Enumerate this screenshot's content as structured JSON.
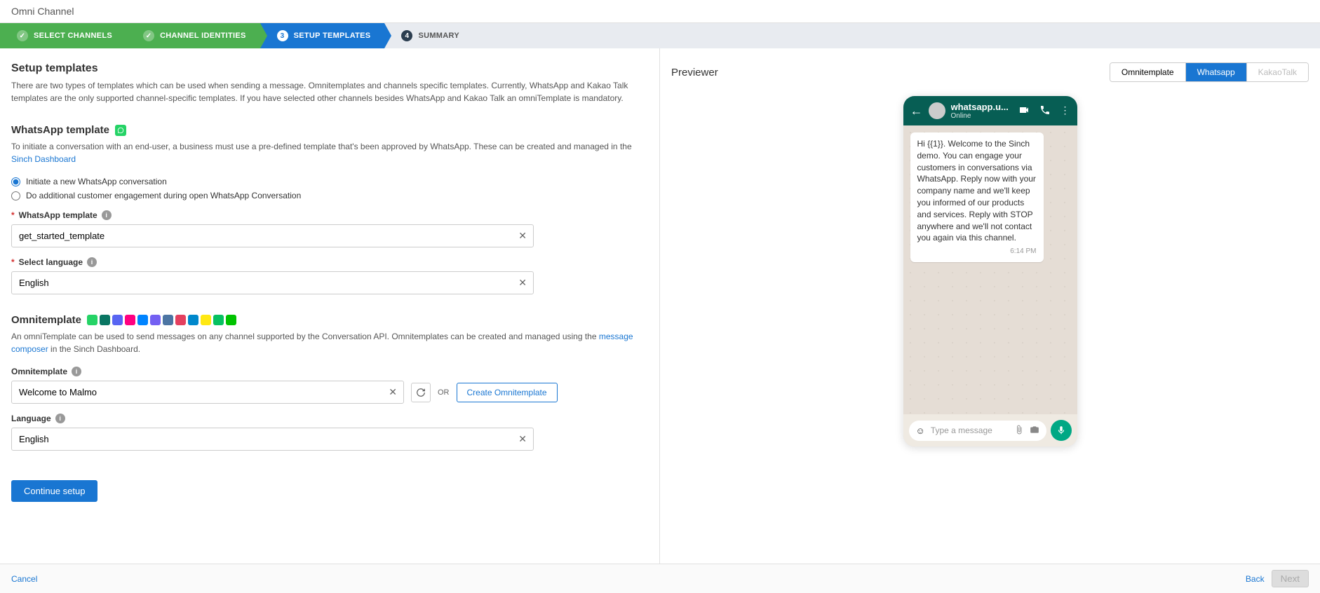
{
  "header": {
    "title": "Omni Channel"
  },
  "stepper": {
    "steps": [
      {
        "label": "SELECT CHANNELS",
        "num": "✓"
      },
      {
        "label": "CHANNEL IDENTITIES",
        "num": "✓"
      },
      {
        "label": "SETUP TEMPLATES",
        "num": "3"
      },
      {
        "label": "SUMMARY",
        "num": "4"
      }
    ]
  },
  "setup": {
    "title": "Setup templates",
    "desc": "There are two types of templates which can be used when sending a message. Omnitemplates and channels specific templates. Currently, WhatsApp and Kakao Talk templates are the only supported channel-specific templates. If you have selected other channels besides WhatsApp and Kakao Talk an omniTemplate is mandatory."
  },
  "whatsapp": {
    "title": "WhatsApp template",
    "desc": "To initiate a conversation with an end-user, a business must use a pre-defined template that's been approved by WhatsApp. These can be created and managed in the ",
    "link": "Sinch Dashboard",
    "radio1": "Initiate a new WhatsApp conversation",
    "radio2": "Do additional customer engagement during open WhatsApp Conversation",
    "template_label": "WhatsApp template",
    "template_value": "get_started_template",
    "lang_label": "Select language",
    "lang_value": "English"
  },
  "omni": {
    "title": "Omnitemplate",
    "desc_pre": "An omniTemplate can be used to send messages on any channel supported by the Conversation API. Omnitemplates can be created and managed using the ",
    "link": "message composer",
    "desc_post": " in the Sinch Dashboard.",
    "template_label": "Omnitemplate",
    "template_value": "Welcome to Malmo",
    "or": "OR",
    "create_btn": "Create Omnitemplate",
    "lang_label": "Language",
    "lang_value": "English"
  },
  "continue_btn": "Continue setup",
  "previewer": {
    "title": "Previewer",
    "tabs": [
      "Omnitemplate",
      "Whatsapp",
      "KakaoTalk"
    ],
    "wa_name": "whatsapp.u...",
    "wa_status": "Online",
    "message": "Hi {{1}}. Welcome to the Sinch demo. You can engage your customers in conversations via WhatsApp. Reply now with your company name and we'll keep you informed of our products and services. Reply with STOP anywhere and we'll not contact you again via this channel.",
    "time": "6:14 PM",
    "placeholder": "Type a message"
  },
  "footer": {
    "cancel": "Cancel",
    "back": "Back",
    "next": "Next"
  }
}
